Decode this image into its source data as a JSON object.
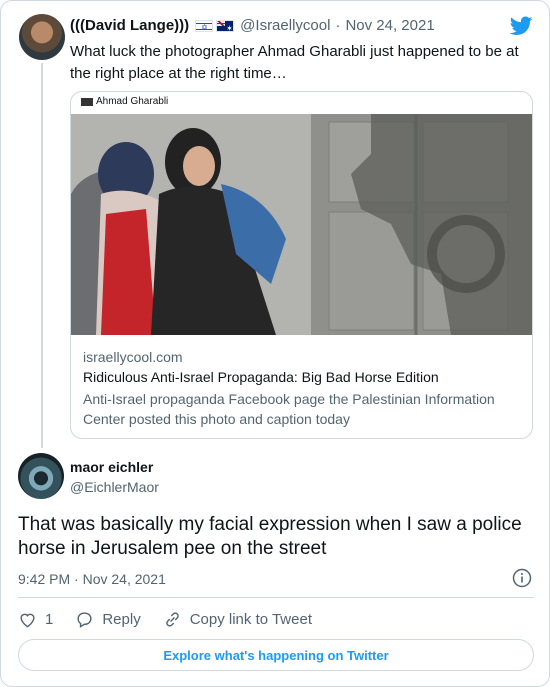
{
  "tweet": {
    "author_name": "(((David Lange)))",
    "author_handle": "@Israellycool",
    "date_separator": "·",
    "date": "Nov 24, 2021",
    "text": "What luck the photographer Ahmad Gharabli just happened to be at the right place at the right time…",
    "flags": [
      "israel-flag",
      "australia-flag"
    ]
  },
  "card": {
    "source": "Ahmad Gharabli",
    "domain": "israellycool.com",
    "title": "Ridiculous Anti-Israel Propaganda: Big Bad Horse Edition",
    "description": "Anti-Israel propaganda Facebook page the Palestinian Information Center posted this photo and caption today"
  },
  "reply": {
    "author_name": "maor eichler",
    "author_handle": "@EichlerMaor",
    "text": "That was basically my facial expression when I saw a police horse in Jerusalem pee on the street",
    "timestamp": "9:42 PM · Nov 24, 2021"
  },
  "actions": {
    "like_count": "1",
    "reply_label": "Reply",
    "copy_link_label": "Copy link to Tweet"
  },
  "explore": {
    "label": "Explore what's happening on Twitter"
  },
  "colors": {
    "twitter_blue": "#1d9bf0",
    "text_secondary": "#536471",
    "border": "#cfd9de"
  }
}
